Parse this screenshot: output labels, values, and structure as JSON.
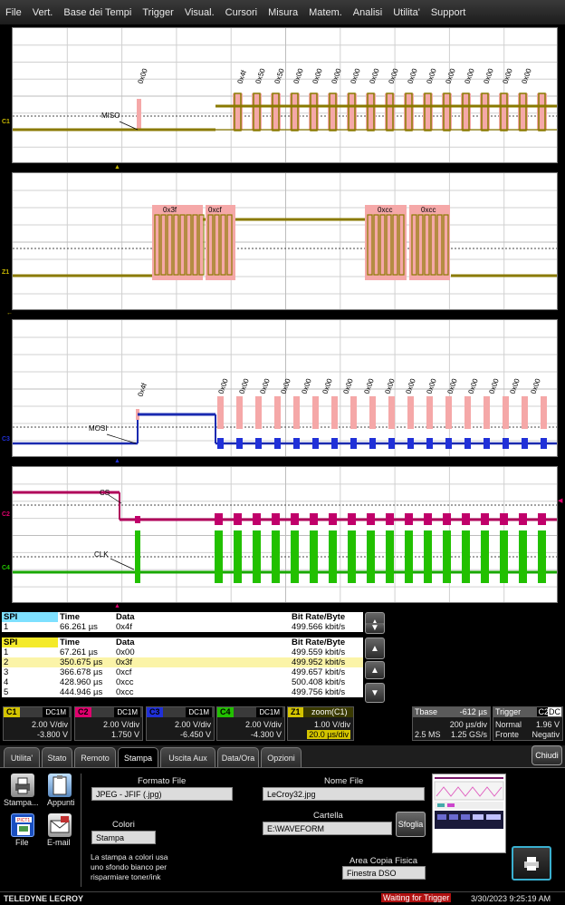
{
  "menu": [
    "File",
    "Vert.",
    "Base dei Tempi",
    "Trigger",
    "Visual.",
    "Cursori",
    "Misura",
    "Matem.",
    "Analisi",
    "Utilita'",
    "Support"
  ],
  "grid1": {
    "label": "MISO",
    "chan": "C1",
    "decodes": [
      "0x00",
      "0x4f",
      "0x50",
      "0x50",
      "0x00",
      "0x00",
      "0x00",
      "0x00",
      "0x00",
      "0x00",
      "0x00",
      "0x00",
      "0x00",
      "0x00",
      "0x00",
      "0x00",
      "0x00"
    ]
  },
  "grid2": {
    "decodes": [
      "0x3f",
      "0xcf",
      "0xcc",
      "0xcc"
    ],
    "chan": "Z1"
  },
  "grid3": {
    "label": "MOSI",
    "chan": "C3",
    "decodes": [
      "0x4f",
      "0x00",
      "0x00",
      "0x00",
      "0x00",
      "0x00",
      "0x00",
      "0x00",
      "0x00",
      "0x00",
      "0x00",
      "0x00",
      "0x00",
      "0x00",
      "0x00",
      "0x00",
      "0x00"
    ]
  },
  "grid4": {
    "label_cs": "CS",
    "label_clk": "CLK",
    "chan2": "C2",
    "chan4": "C4"
  },
  "table1": {
    "headers": [
      "SPI",
      "Time",
      "Data",
      "Bit Rate/Byte"
    ],
    "rows": [
      [
        "1",
        "66.261 µs",
        "0x4f",
        "499.566 kbit/s"
      ]
    ]
  },
  "table2": {
    "headers": [
      "SPI",
      "Time",
      "Data",
      "Bit Rate/Byte"
    ],
    "rows": [
      [
        "1",
        "67.261 µs",
        "0x00",
        "499.559 kbit/s"
      ],
      [
        "2",
        "350.675 µs",
        "0x3f",
        "499.952 kbit/s"
      ],
      [
        "3",
        "366.678 µs",
        "0xcf",
        "499.657 kbit/s"
      ],
      [
        "4",
        "428.960 µs",
        "0xcc",
        "500.408 kbit/s"
      ],
      [
        "5",
        "444.946 µs",
        "0xcc",
        "499.756 kbit/s"
      ]
    ]
  },
  "channels": [
    {
      "tag": "C1",
      "coupling": "DC1M",
      "vdiv": "2.00 V/div",
      "offset": "-3.800 V",
      "color": "#d4c400"
    },
    {
      "tag": "C2",
      "coupling": "DC1M",
      "vdiv": "2.00 V/div",
      "offset": "1.750 V",
      "color": "#e0006e"
    },
    {
      "tag": "C3",
      "coupling": "DC1M",
      "vdiv": "2.00 V/div",
      "offset": "-6.450 V",
      "color": "#2030d8"
    },
    {
      "tag": "C4",
      "coupling": "DC1M",
      "vdiv": "2.00 V/div",
      "offset": "-4.300 V",
      "color": "#22c000"
    }
  ],
  "zoom": {
    "tag": "Z1",
    "title": "zoom(C1)",
    "vdiv": "1.00 V/div",
    "tdiv": "20.0 µs/div"
  },
  "timebase": {
    "label": "Tbase",
    "offset": "-612 µs",
    "tdiv": "200 µs/div",
    "samples": "2.5 MS",
    "rate": "1.25 GS/s"
  },
  "trigger": {
    "label": "Trigger",
    "chan": "C2",
    "coupling": "DC",
    "mode": "Normal",
    "level": "1.96 V",
    "type": "Fronte",
    "slope": "Negativ"
  },
  "tabs": [
    "Utilita'",
    "Stato",
    "Remoto",
    "Stampa",
    "Uscita Aux",
    "Data/Ora",
    "Opzioni"
  ],
  "active_tab": "Stampa",
  "close_label": "Chiudi",
  "print": {
    "icon_stampa": "Stampa...",
    "icon_appunti": "Appunti",
    "icon_file": "File",
    "icon_email": "E-mail",
    "formato_label": "Formato File",
    "formato_value": "JPEG - JFIF (.jpg)",
    "colori_label": "Colori",
    "colori_value": "Stampa",
    "note": "La stampa a colori usa uno sfondo bianco per risparmiare toner/ink",
    "nome_label": "Nome File",
    "nome_value": "LeCroy32.jpg",
    "cartella_label": "Cartella",
    "cartella_value": "E:\\WAVEFORM",
    "sfoglia_label": "Sfoglia",
    "area_label": "Area Copia Fisica",
    "area_value": "Finestra DSO"
  },
  "status": {
    "brand": "TELEDYNE LECROY",
    "trigger_state": "Waiting for Trigger",
    "datetime": "3/30/2023 9:25:19 AM"
  }
}
